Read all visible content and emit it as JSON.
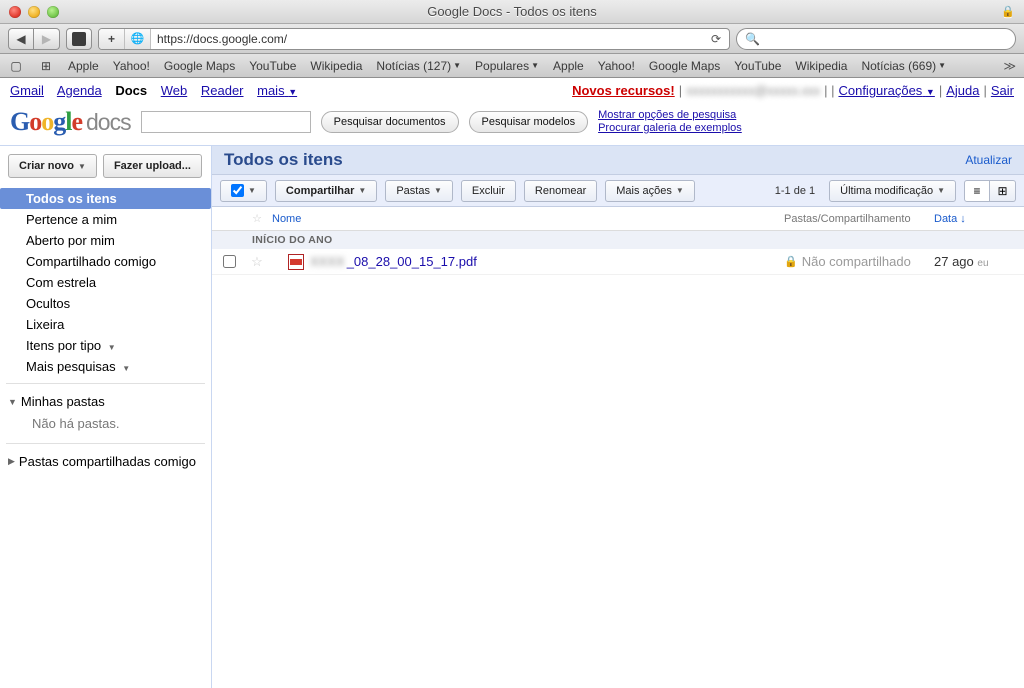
{
  "window": {
    "title": "Google Docs - Todos os itens"
  },
  "url": "https://docs.google.com/",
  "bookmarks": [
    "Apple",
    "Yahoo!",
    "Google Maps",
    "YouTube",
    "Wikipedia",
    "Notícias (127)",
    "Populares",
    "Apple",
    "Yahoo!",
    "Google Maps",
    "YouTube",
    "Wikipedia",
    "Notícias (669)"
  ],
  "gbar": {
    "left": [
      "Gmail",
      "Agenda",
      "Docs",
      "Web",
      "Reader",
      "mais"
    ],
    "active": "Docs",
    "novos": "Novos recursos!",
    "config": "Configurações",
    "help": "Ajuda",
    "signout": "Sair"
  },
  "logo_tail": "docs",
  "search": {
    "btn_docs": "Pesquisar documentos",
    "btn_tmpl": "Pesquisar modelos",
    "link_opts": "Mostrar opções de pesquisa",
    "link_gallery": "Procurar galeria de exemplos"
  },
  "sidebar": {
    "btn_new": "Criar novo",
    "btn_upload": "Fazer upload...",
    "items": [
      "Todos os itens",
      "Pertence a mim",
      "Aberto por mim",
      "Compartilhado comigo",
      "Com estrela",
      "Ocultos",
      "Lixeira",
      "Itens por tipo",
      "Mais pesquisas"
    ],
    "my_folders": "Minhas pastas",
    "no_folders": "Não há pastas.",
    "shared_folders": "Pastas compartilhadas comigo"
  },
  "content": {
    "title": "Todos os itens",
    "refresh": "Atualizar",
    "tools": {
      "share": "Compartilhar",
      "folders": "Pastas",
      "del": "Excluir",
      "rename": "Renomear",
      "more": "Mais ações",
      "sort": "Última modificação"
    },
    "count": "1-1 de 1",
    "cols": {
      "name": "Nome",
      "share": "Pastas/Compartilhamento",
      "date": "Data"
    },
    "group": "INÍCIO DO ANO",
    "items": [
      {
        "name": "_08_28_00_15_17.pdf",
        "shared": "Não compartilhado",
        "date": "27 ago",
        "owner": "eu"
      }
    ]
  }
}
